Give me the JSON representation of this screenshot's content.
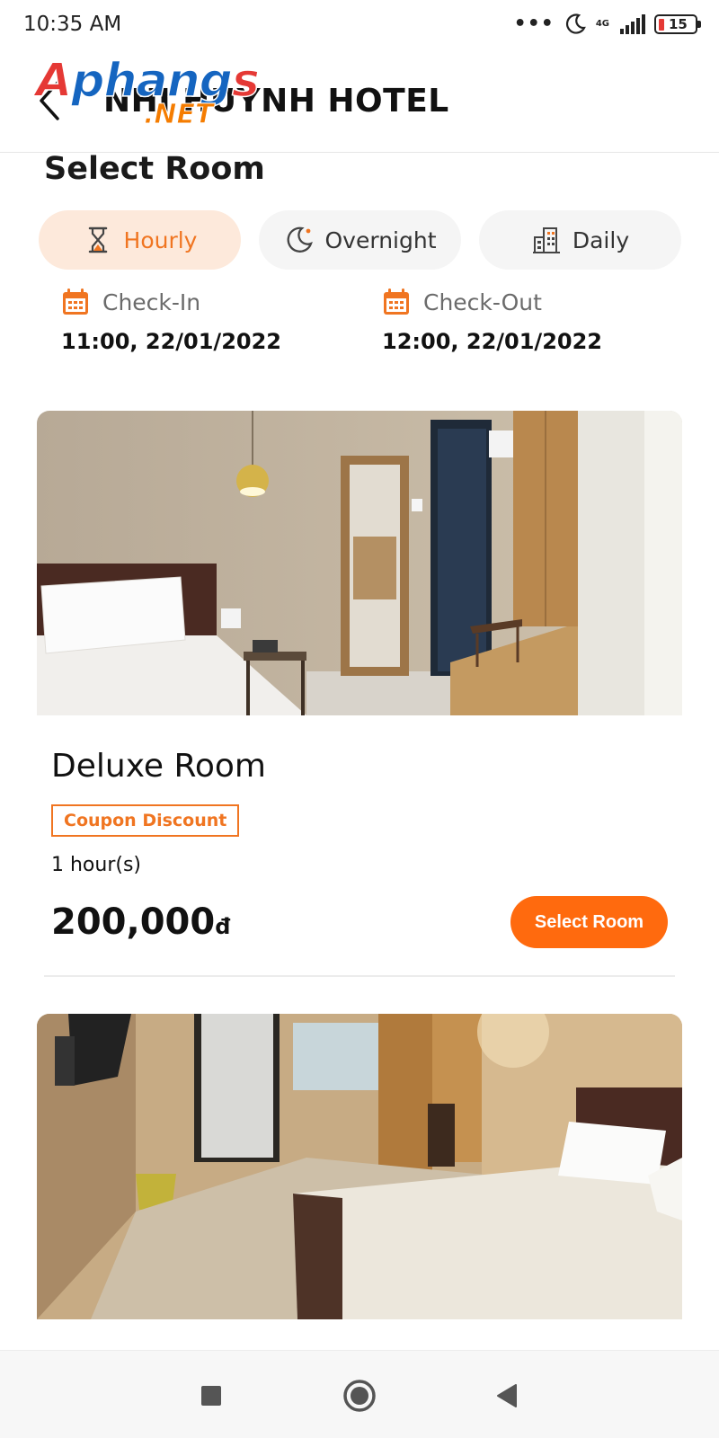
{
  "status_bar": {
    "time": "10:35 AM",
    "more": "•••",
    "network": "4G",
    "battery": "15"
  },
  "header": {
    "title": "NHI HUỲNH HOTEL",
    "watermark_main": "Aphangs",
    "watermark_sub": ".NET"
  },
  "page": {
    "section_title": "Select Room"
  },
  "tabs": [
    {
      "label": "Hourly",
      "icon": "hourglass-icon",
      "active": true
    },
    {
      "label": "Overnight",
      "icon": "moon-icon",
      "active": false
    },
    {
      "label": "Daily",
      "icon": "building-icon",
      "active": false
    }
  ],
  "checkin": {
    "label": "Check-In",
    "value": "11:00, 22/01/2022"
  },
  "checkout": {
    "label": "Check-Out",
    "value": "12:00, 22/01/2022"
  },
  "rooms": [
    {
      "name": "Deluxe Room",
      "badge": "Coupon Discount",
      "duration": "1 hour(s)",
      "price": "200,000",
      "currency": "đ",
      "button": "Select Room"
    }
  ],
  "colors": {
    "accent": "#ff6a0e",
    "accent_text": "#f07521",
    "active_tab_bg": "#fde9db"
  }
}
